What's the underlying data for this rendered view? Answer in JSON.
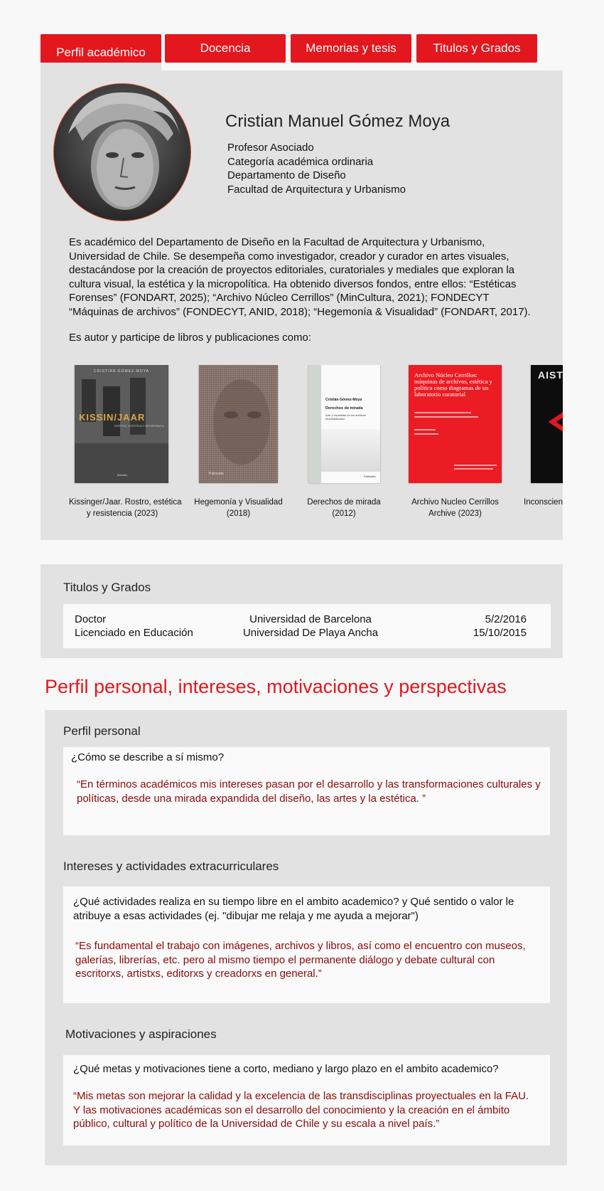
{
  "tabs": [
    {
      "label": "Perfil académico",
      "active": true
    },
    {
      "label": "Docencia",
      "active": false
    },
    {
      "label": "Memorias y tesis",
      "active": false
    },
    {
      "label": "Titulos y Grados",
      "active": false
    }
  ],
  "profile": {
    "name": "Cristian Manuel Gómez Moya",
    "roles": [
      "Profesor Asociado",
      "Categoría académica ordinaria",
      "Departamento de Diseño",
      "Facultad de Arquitectura y Urbanismo"
    ],
    "bio": "Es académico del Departamento de Diseño en la Facultad de Arquitectura y Urbanismo, Universidad de Chile. Se desempeña como investigador, creador y curador en artes visuales, destacándose por la creación de proyectos editoriales, curatoriales y mediales que exploran la cultura visual, la estética y la micropolítica. Ha obtenido diversos fondos, entre ellos: “Estéticas Forenses” (FONDART, 2025); “Archivo Núcleo Cerrillos” (MinCultura, 2021); FONDECYT “Máquinas de archivos” (FONDECYT, ANID, 2018); “Hegemonía & Visualidad” (FONDART, 2017).",
    "books_intro": "Es autor y participe de libros y publicaciones como:"
  },
  "books": [
    {
      "caption_line1": "Kissinger/Jaar. Rostro, estética",
      "caption_line2": "y resistencia (2023)",
      "cover_author": "CRISTIÁN GÓMEZ-MOYA",
      "cover_title": "KISSIN/JAAR",
      "cover_subtitle": "ROSTRO, ESTÉTICA Y RESISTENCIA",
      "cover_publisher": "Metales"
    },
    {
      "caption_line1": "Hegemonía y Visualidad",
      "caption_line2": "(2018)",
      "cover_publisher": "Palinodia"
    },
    {
      "caption_line1": "Derechos de mirada",
      "caption_line2": "(2012)",
      "cover_author": "Cristián Gómez-Moya",
      "cover_title": "Derechos de mirada",
      "cover_subtitle": "Arte y visualidad en los archivos desclasificados",
      "cover_publisher": "Palinodia"
    },
    {
      "caption_line1": "Archivo Nucleo Cerrillos",
      "caption_line2": "Archive (2023)",
      "cover_title": "Archivo Núcleo Cerrillos: máquinas de archivos, estética y política como diagramas de un laboratorio curatorial"
    },
    {
      "caption_line1": "Inconsciente",
      "caption_line2": "",
      "cover_title": "AISTH"
    }
  ],
  "grades": {
    "title": "Titulos y Grados",
    "rows": [
      {
        "degree": "Doctor",
        "institution": "Universidad de Barcelona",
        "date": "5/2/2016"
      },
      {
        "degree": "Licenciado en Educación",
        "institution": "Universidad De Playa Ancha",
        "date": "15/10/2015"
      }
    ]
  },
  "personal_section": {
    "heading": "Perfil personal, intereses, motivaciones y perspectivas",
    "blocks": [
      {
        "title": "Perfil personal",
        "question": "¿Cómo se describe a sí mismo?",
        "answer": "“En términos académicos mis intereses pasan por el desarrollo y las transformaciones culturales y políticas, desde una mirada expandida del diseño, las artes y la estética. ”"
      },
      {
        "title": "Intereses y actividades extracurriculares",
        "question": "¿Qué actividades realiza en su tiempo libre en el ambito academico? y Qué sentido o valor le atribuye a esas actividades (ej. \"dibujar me relaja y me ayuda a mejorar\")",
        "answer": "“Es fundamental el trabajo con imágenes, archivos y libros, así como el encuentro con museos, galerías, librerías, etc. pero al mismo tiempo el permanente diálogo y debate cultural con escritorxs, artistxs, editorxs y creadorxs en general.”"
      },
      {
        "title": "Motivaciones y aspiraciones",
        "question": "¿Qué metas y motivaciones tiene a corto, mediano y largo plazo en el ambito academico?",
        "answer": "“Mis metas son mejorar la calidad y la excelencia de las transdisciplinas proyectuales en la FAU. Y las motivaciones académicas son el desarrollo del conocimiento y la creación en el ámbito público, cultural y político de la Universidad de Chile y su escala a nivel país.”"
      }
    ]
  },
  "colors": {
    "accent_red": "#e3171e",
    "answer_red": "#8a0a0a",
    "panel_gray": "#e2e2e2"
  }
}
